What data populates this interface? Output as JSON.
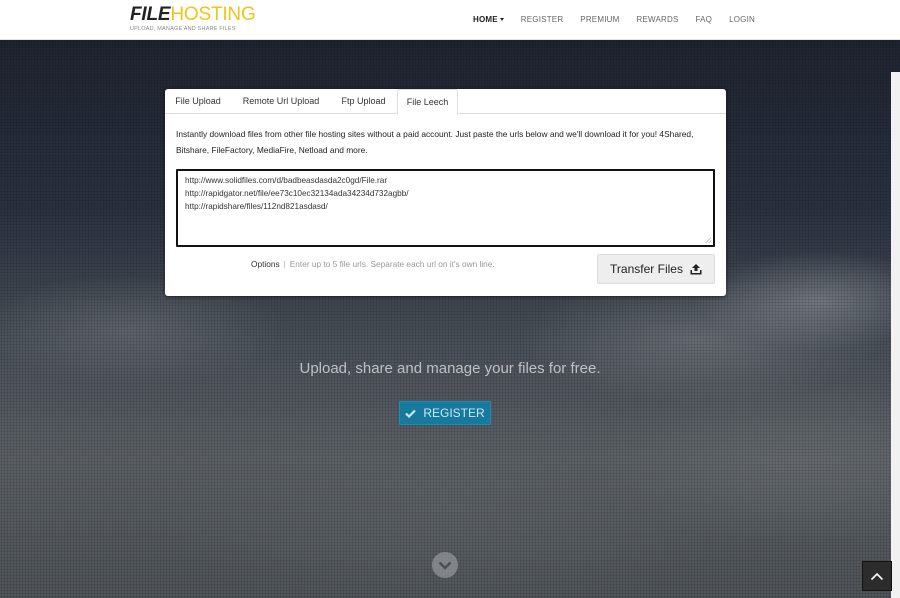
{
  "header": {
    "logo_part1": "FILE",
    "logo_part2": "HOSTING",
    "tagline": "UPLOAD, MANAGE AND SHARE FILES",
    "nav": [
      {
        "label": "HOME",
        "active": true
      },
      {
        "label": "REGISTER"
      },
      {
        "label": "PREMIUM"
      },
      {
        "label": "REWARDS"
      },
      {
        "label": "FAQ"
      },
      {
        "label": "LOGIN"
      }
    ]
  },
  "upload_panel": {
    "tabs": [
      {
        "label": "File Upload"
      },
      {
        "label": "Remote Url Upload"
      },
      {
        "label": "Ftp Upload"
      },
      {
        "label": "File Leech",
        "active": true
      }
    ],
    "description": "Instantly download files from other file hosting sites without a paid account. Just paste the urls below and we'll download it for you! 4Shared, Bitshare, FileFactory, MediaFire, Netload and more.",
    "urls": [
      "http://www.solidfiles.com/d/badbeasdasda2c0gd/File.rar",
      "http://rapidgator.net/file/ee73c10ec32134ada34234d732agbb/",
      "http://rapidshare/files/112nd821asdasd/"
    ],
    "options_label": "Options",
    "separator": "|",
    "hint": "Enter up to 5 file urls. Separate each url on it's own line.",
    "transfer_button": "Transfer Files"
  },
  "hero": {
    "tagline": "Upload, share and manage your files for free.",
    "register_button": "REGISTER"
  },
  "colors": {
    "accent_yellow": "#f0c419",
    "register_blue": "#16799e"
  },
  "icons": {
    "upload": "upload-icon",
    "check": "check-icon",
    "scroll_down": "chevron-down-icon",
    "back_to_top": "chevron-up-icon"
  }
}
